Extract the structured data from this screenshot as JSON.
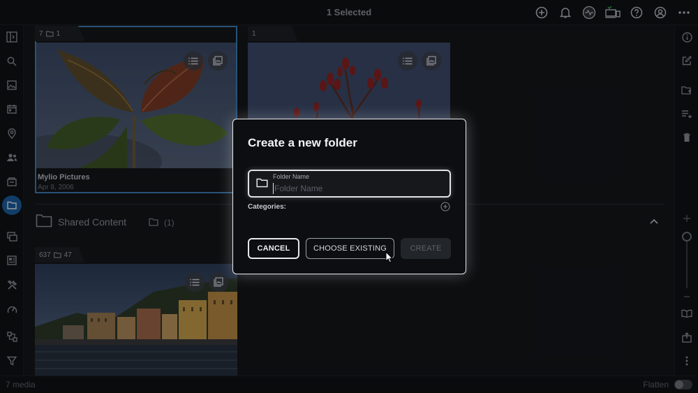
{
  "topbar": {
    "title": "1 Selected",
    "icons": [
      "add-icon",
      "bell-icon",
      "activity-icon",
      "devices-icon",
      "help-icon",
      "account-icon",
      "more-icon"
    ]
  },
  "leftrail": {
    "items": [
      "sidebar-toggle-icon",
      "search-icon",
      "photos-icon",
      "calendar-icon",
      "map-pin-icon",
      "people-icon",
      "albums-icon",
      "folders-icon",
      "slideshow-icon",
      "dashboard-icon",
      "tools-icon",
      "speed-icon",
      "sources-icon",
      "filter-icon"
    ],
    "active": "folders-icon"
  },
  "rightrail": {
    "items": [
      "info-icon",
      "edit-icon",
      "add-folder-icon",
      "add-list-icon",
      "trash-icon",
      "zoom-in-icon",
      "zoom-out-icon",
      "book-icon",
      "export-icon",
      "more-vert-icon"
    ]
  },
  "cards": [
    {
      "tab_count": "7",
      "tab_folders": "1",
      "name": "Mylio Pictures",
      "date": "Apr 8, 2006",
      "selected": true
    },
    {
      "tab_count": "1",
      "tab_folders": "",
      "name": "",
      "date": "",
      "selected": false
    },
    {
      "tab_count": "637",
      "tab_folders": "47",
      "name": "",
      "date": "",
      "selected": false
    }
  ],
  "section": {
    "label": "Shared Content",
    "count": "(1)"
  },
  "bottombar": {
    "media_count": "7 media",
    "flatten_label": "Flatten"
  },
  "modal": {
    "title": "Create a new folder",
    "field_label": "Folder Name",
    "field_placeholder": "Folder Name",
    "field_value": "",
    "categories_label": "Categories:",
    "cancel_label": "CANCEL",
    "choose_existing_label": "CHOOSE EXISTING",
    "create_label": "CREATE"
  },
  "colors": {
    "accent": "#1b5fa0",
    "background": "#121418",
    "modal_border": "#e8eaed"
  }
}
